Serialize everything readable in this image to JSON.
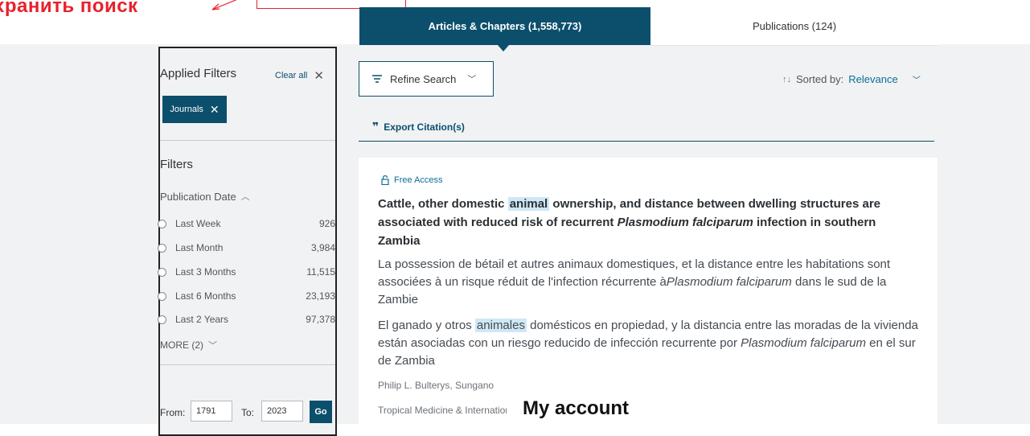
{
  "annotation": {
    "text": "хранить поиск"
  },
  "tabs": {
    "articles": "Articles & Chapters (1,558,773)",
    "publications": "Publications (124)"
  },
  "sidebar": {
    "applied_title": "Applied Filters",
    "clear_all": "Clear all",
    "chip": "Journals",
    "filters_title": "Filters",
    "pub_date": "Publication Date",
    "options": [
      {
        "label": "Last Week",
        "count": "926"
      },
      {
        "label": "Last Month",
        "count": "3,984"
      },
      {
        "label": "Last 3 Months",
        "count": "11,515"
      },
      {
        "label": "Last 6 Months",
        "count": "23,193"
      },
      {
        "label": "Last 2 Years",
        "count": "97,378"
      }
    ],
    "more": "MORE (2)",
    "from_label": "From:",
    "from_value": "1791",
    "to_label": "To:",
    "to_value": "2023",
    "go": "Go"
  },
  "controls": {
    "refine": "Refine Search",
    "sorted_prefix": "Sorted by:",
    "sorted_value": "Relevance",
    "export": "Export Citation(s)"
  },
  "result": {
    "access": "Free Access",
    "title_a": "Cattle, other domestic ",
    "title_hl": "animal",
    "title_b": " ownership, and distance between dwelling structures are associated with reduced risk of recurrent ",
    "title_italic": "Plasmodium falciparum",
    "title_c": " infection in southern Zambia",
    "fr_a": "La possession de bétail et autres animaux domestiques, et la distance entre les habitations sont associées à un risque réduit de l'infection récurrente à",
    "fr_italic": "Plasmodium falciparum",
    "fr_b": " dans le sud de la Zambie",
    "es_a": "El ganado y otros ",
    "es_hl": "animales",
    "es_b": " domésticos en propiedad, y la distancia entre las moradas de la vivienda están asociadas con un riesgo reducido de infección recurrente por ",
    "es_italic": "Plasmodium falciparum",
    "es_c": " en el sur de Zambia",
    "authors": "Philip L. Bulterys, Sungano",
    "journal": "Tropical Medicine & International Health"
  },
  "overlay": {
    "my_account": "My account"
  },
  "colors": {
    "accent": "#0b4f6c",
    "annotation": "#e8212d",
    "highlight": "#cfe8f5"
  }
}
